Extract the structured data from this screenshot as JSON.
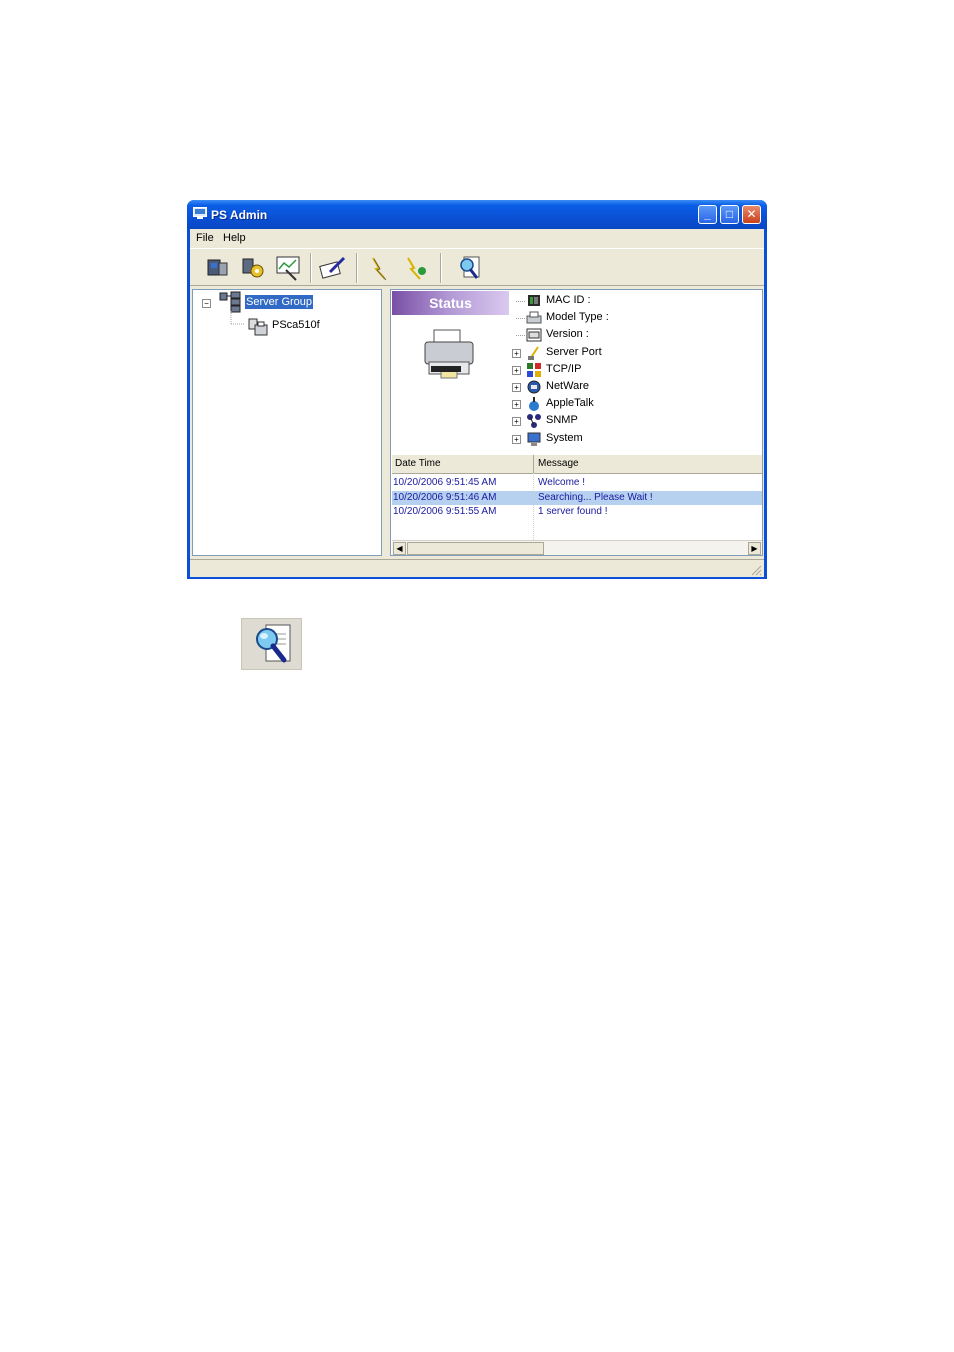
{
  "window": {
    "title": "PS Admin",
    "controls": {
      "minimize": "_",
      "maximize": "□",
      "close": "✕"
    }
  },
  "menubar": {
    "items": [
      "File",
      "Help"
    ]
  },
  "toolbar": {
    "icons": [
      "printer-server-icon",
      "settings-icon",
      "chart-icon",
      "edit-icon",
      "upgrade-icon",
      "upgrade-restore-icon",
      "search-icon"
    ]
  },
  "tree": {
    "root": "Server Group",
    "child": "PSca510f",
    "collapse_symbol": "−"
  },
  "status_panel": {
    "banner": "Status",
    "properties": [
      {
        "label": "MAC ID :",
        "icon": "chip-icon",
        "expandable": false
      },
      {
        "label": "Model Type :",
        "icon": "model-icon",
        "expandable": false
      },
      {
        "label": "Version :",
        "icon": "version-icon",
        "expandable": false
      },
      {
        "label": "Server Port",
        "icon": "port-icon",
        "expandable": true
      },
      {
        "label": "TCP/IP",
        "icon": "network-icon",
        "expandable": true
      },
      {
        "label": "NetWare",
        "icon": "netware-icon",
        "expandable": true
      },
      {
        "label": "AppleTalk",
        "icon": "apple-icon",
        "expandable": true
      },
      {
        "label": "SNMP",
        "icon": "snmp-icon",
        "expandable": true
      },
      {
        "label": "System",
        "icon": "system-icon",
        "expandable": true
      }
    ],
    "expand_symbol": "+"
  },
  "log": {
    "columns": [
      "Date Time",
      "Message"
    ],
    "rows": [
      {
        "datetime": "10/20/2006 9:51:45 AM",
        "message": "Welcome !",
        "selected": false
      },
      {
        "datetime": "10/20/2006 9:51:46 AM",
        "message": "Searching... Please Wait !",
        "selected": true
      },
      {
        "datetime": "10/20/2006 9:51:55 AM",
        "message": "1 server found !",
        "selected": false
      }
    ]
  },
  "standalone_icon": "search-server-icon",
  "colors": {
    "titlebar": "#0a50d6",
    "selection": "#316ac5",
    "log_text": "#1a1aa0",
    "banner": "#9b7cc4"
  }
}
